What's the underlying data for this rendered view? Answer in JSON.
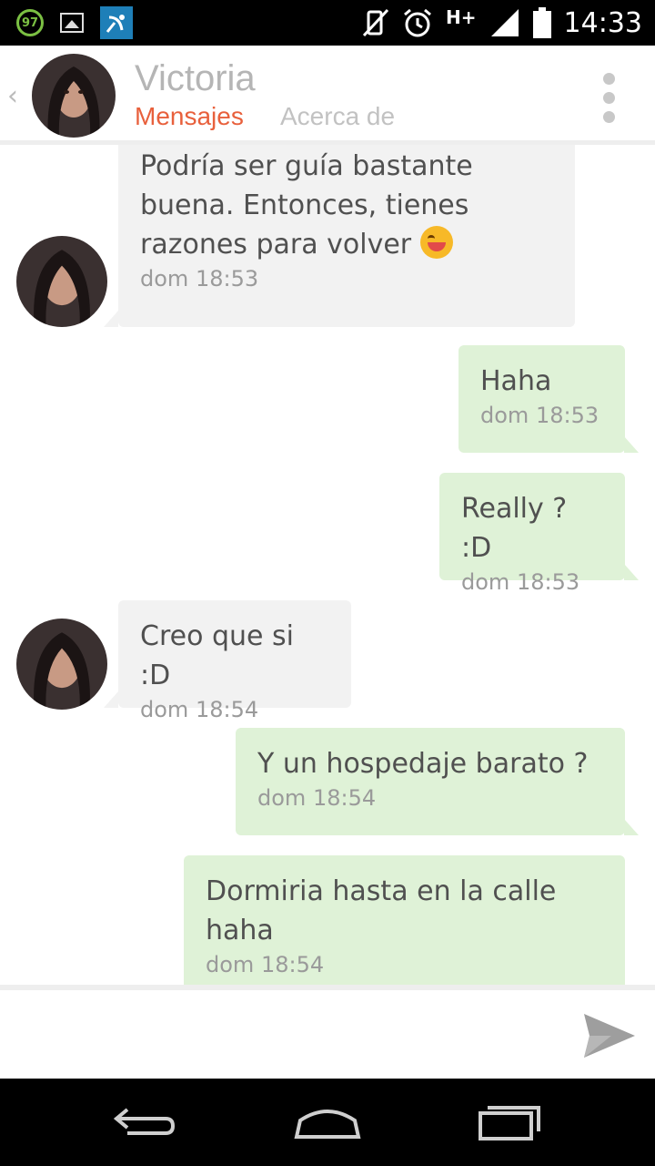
{
  "status_bar": {
    "notification_badge": "97",
    "network": "H+",
    "time": "14:33",
    "icons": [
      "photo-icon",
      "satellite-dish-icon",
      "vibrate-off-icon",
      "alarm-icon",
      "signal-icon",
      "battery-icon"
    ]
  },
  "header": {
    "contact_name": "Victoria",
    "tabs": [
      {
        "label": "Mensajes",
        "active": true
      },
      {
        "label": "Acerca de",
        "active": false
      }
    ],
    "accent_color": "#e8603c"
  },
  "messages": [
    {
      "direction": "in",
      "text_lines": [
        "Podría ser guía bastante",
        "buena. Entonces, tienes",
        "razones para volver"
      ],
      "emoji": "smiling-face-emoji",
      "day": "dom",
      "time": "18:53"
    },
    {
      "direction": "out",
      "text_lines": [
        "Haha"
      ],
      "day": "dom",
      "time": "18:53"
    },
    {
      "direction": "out",
      "text_lines": [
        "Really ? :D"
      ],
      "day": "dom",
      "time": "18:53"
    },
    {
      "direction": "in",
      "text_lines": [
        "Creo que si :D"
      ],
      "day": "dom",
      "time": "18:54"
    },
    {
      "direction": "out",
      "text_lines": [
        "Y un hospedaje barato ?"
      ],
      "day": "dom",
      "time": "18:54"
    },
    {
      "direction": "out",
      "text_lines": [
        "Dormiria hasta en la calle",
        "haha"
      ],
      "day": "dom",
      "time": "18:54"
    }
  ],
  "composer": {
    "value": "",
    "placeholder": ""
  },
  "colors": {
    "incoming_bubble": "#f2f2f2",
    "outgoing_bubble": "#dff2d7"
  }
}
